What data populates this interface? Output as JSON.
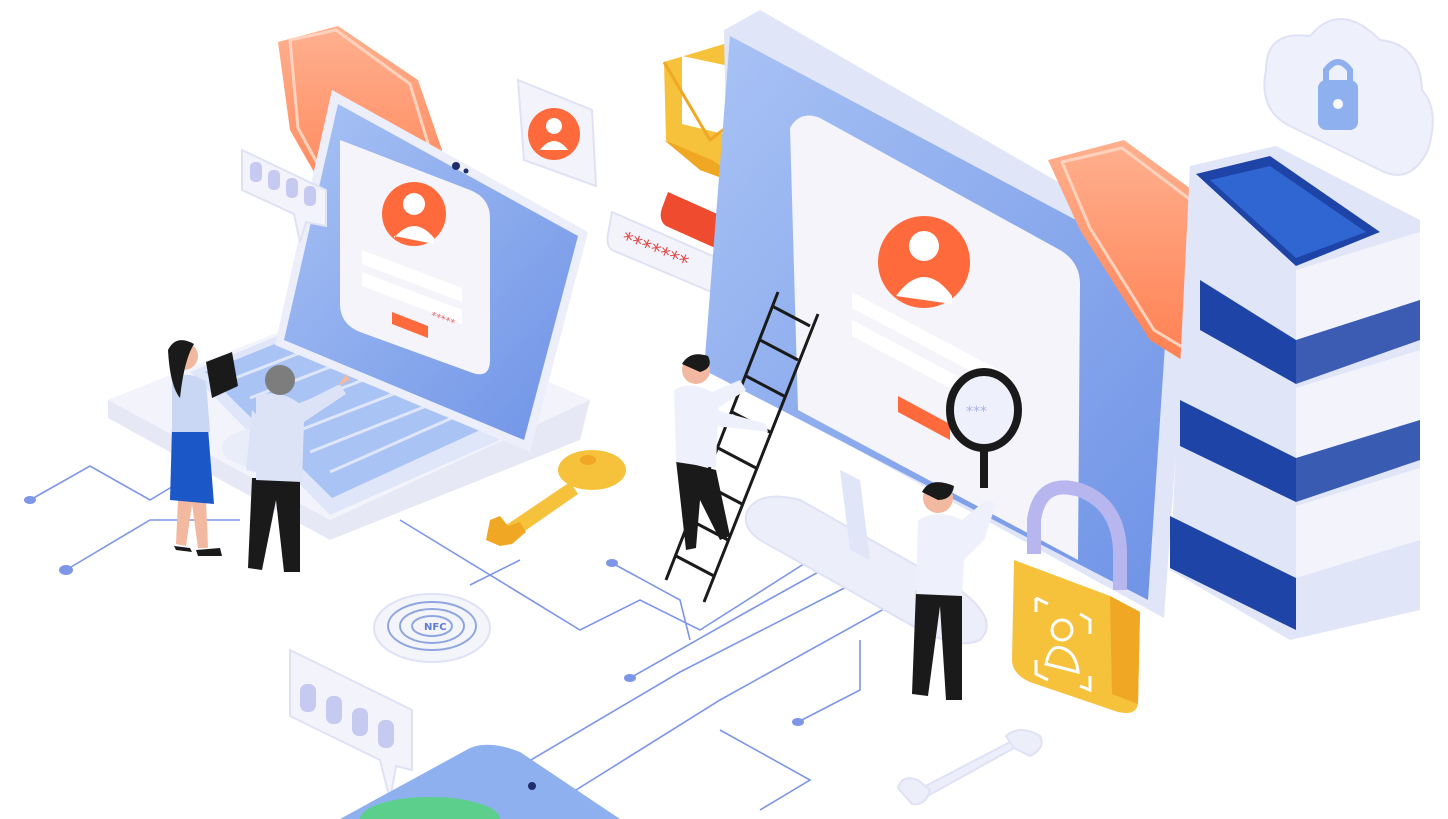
{
  "illustration": {
    "laptop_password_mask": "*****",
    "password_bubble_mask": "*******",
    "monitor_magnified_mask": "***",
    "nfc_label": "NFC"
  },
  "colors": {
    "accent_orange": "#ff6a3d",
    "screen_blue": "#8fb0ee",
    "line_blue": "#7d96e6",
    "key_yellow": "#f6c13b",
    "server_navy": "#1d44a6"
  }
}
